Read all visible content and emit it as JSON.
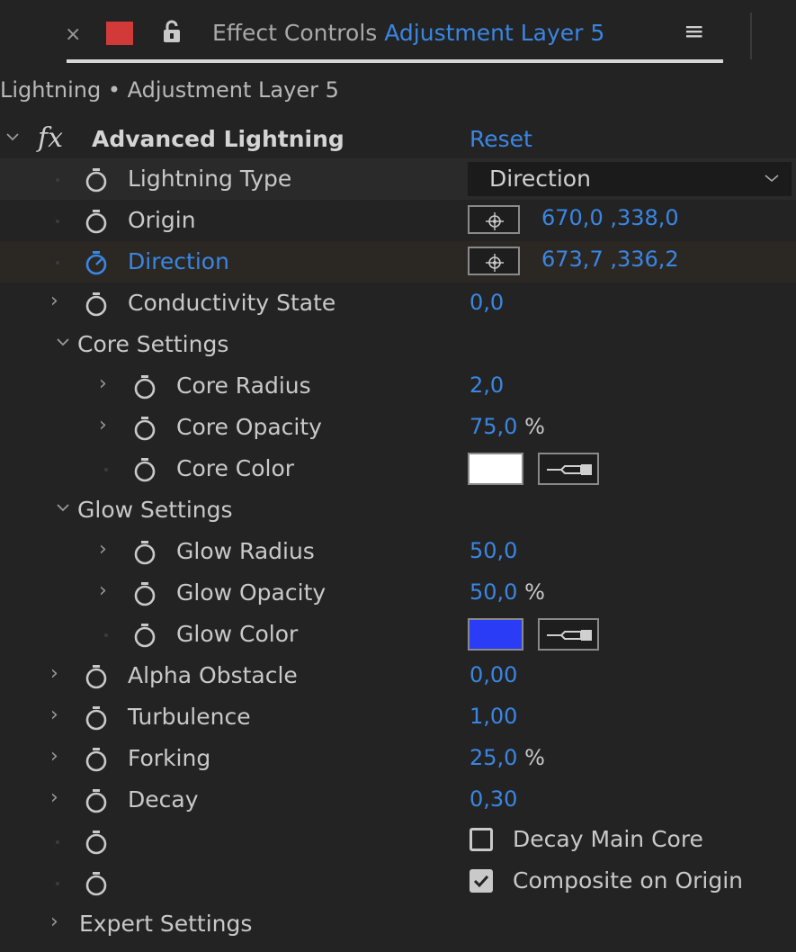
{
  "tab": {
    "close_glyph": "×",
    "label_color": "#d23a3a",
    "title": "Effect Controls",
    "layer": "Adjustment Layer 5",
    "menu_glyph": "≡"
  },
  "breadcrumb": "Lightning • Adjustment Layer 5",
  "effect": {
    "fx_glyph": "fx",
    "name": "Advanced Lightning",
    "reset_label": "Reset"
  },
  "props": {
    "lightning_type": {
      "label": "Lightning Type",
      "value": "Direction"
    },
    "origin": {
      "label": "Origin",
      "value": "670,0 ,338,0"
    },
    "direction": {
      "label": "Direction",
      "value": "673,7 ,336,2"
    },
    "conductivity": {
      "label": "Conductivity State",
      "value": "0,0"
    },
    "core_settings": {
      "label": "Core Settings"
    },
    "core_radius": {
      "label": "Core Radius",
      "value": "2,0"
    },
    "core_opacity": {
      "label": "Core Opacity",
      "value": "75,0",
      "unit": "%"
    },
    "core_color": {
      "label": "Core Color",
      "color": "#ffffff"
    },
    "glow_settings": {
      "label": "Glow Settings"
    },
    "glow_radius": {
      "label": "Glow Radius",
      "value": "50,0"
    },
    "glow_opacity": {
      "label": "Glow Opacity",
      "value": "50,0",
      "unit": "%"
    },
    "glow_color": {
      "label": "Glow Color",
      "color": "#2a3cf5"
    },
    "alpha_obstacle": {
      "label": "Alpha Obstacle",
      "value": "0,00"
    },
    "turbulence": {
      "label": "Turbulence",
      "value": "1,00"
    },
    "forking": {
      "label": "Forking",
      "value": "25,0",
      "unit": "%"
    },
    "decay": {
      "label": "Decay",
      "value": "0,30"
    },
    "decay_main_core": {
      "label": "Decay Main Core",
      "checked": false
    },
    "composite_on_origin": {
      "label": "Composite on Origin",
      "checked": true
    },
    "expert_settings": {
      "label": "Expert Settings"
    }
  },
  "colors": {
    "accent": "#3a86e3",
    "panel_bg": "#232323",
    "text": "#c9c9c9"
  }
}
